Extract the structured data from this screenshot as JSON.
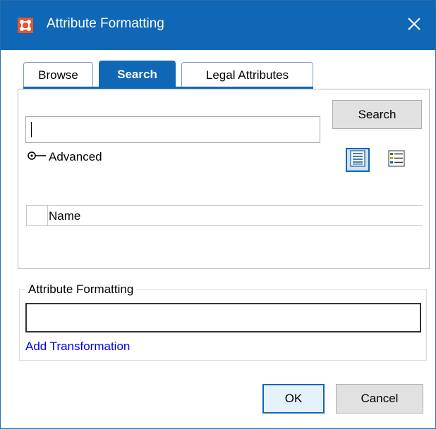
{
  "window": {
    "title": "Attribute Formatting",
    "app_icon": "app-logo-icon",
    "close_icon": "close-icon",
    "accent_color": "#0f67b5"
  },
  "tabs": [
    {
      "label": "Browse",
      "active": false
    },
    {
      "label": "Search",
      "active": true
    },
    {
      "label": "Legal Attributes",
      "active": false
    }
  ],
  "search": {
    "input_value": "",
    "button_label": "Search"
  },
  "advanced": {
    "label": "Advanced",
    "icon": "expander-key-icon"
  },
  "view_toggles": [
    {
      "name": "list-view-icon",
      "selected": true
    },
    {
      "name": "details-view-icon",
      "selected": false
    }
  ],
  "results_table": {
    "columns": [
      "",
      "Name"
    ],
    "rows": []
  },
  "attribute_formatting": {
    "group_label": "Attribute Formatting",
    "value": "",
    "add_link": "Add Transformation"
  },
  "footer": {
    "ok_label": "OK",
    "cancel_label": "Cancel"
  }
}
